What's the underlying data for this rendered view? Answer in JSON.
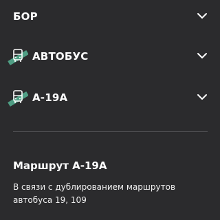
{
  "city_selector": {
    "value": "БОР",
    "expand_icon": "chevron-down-icon"
  },
  "transport_selector": {
    "value": "АВТОБУС",
    "icon": "bus-icon",
    "expand_icon": "chevron-down-icon"
  },
  "route_selector": {
    "value": "А-19А",
    "icon": "bus-icon",
    "expand_icon": "chevron-down-icon"
  },
  "route_info": {
    "title": "Маршрут А-19А",
    "description": "В связи с дублированием маршрутов автобуса 19, 109"
  },
  "colors": {
    "background": "#2b2b2d",
    "text": "#ffffff",
    "accent": "#4f9e84",
    "divider": "#505053"
  }
}
